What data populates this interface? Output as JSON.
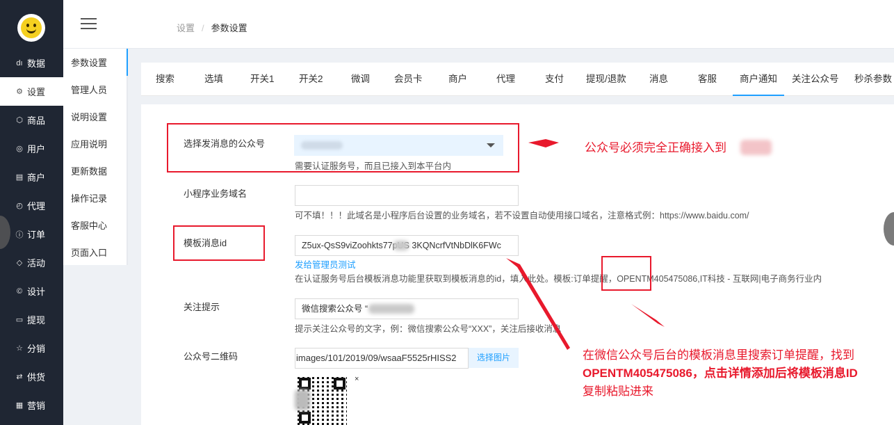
{
  "sidebar": {
    "items": [
      {
        "icon": "bar-chart-icon",
        "glyph": "dı",
        "label": "数据"
      },
      {
        "icon": "gear-icon",
        "glyph": "⚙",
        "label": "设置"
      },
      {
        "icon": "cube-icon",
        "glyph": "⬡",
        "label": "商品"
      },
      {
        "icon": "user-icon",
        "glyph": "◎",
        "label": "用户"
      },
      {
        "icon": "shop-icon",
        "glyph": "▤",
        "label": "商户"
      },
      {
        "icon": "agent-icon",
        "glyph": "◴",
        "label": "代理"
      },
      {
        "icon": "order-icon",
        "glyph": "ⓘ",
        "label": "订单"
      },
      {
        "icon": "tag-icon",
        "glyph": "◇",
        "label": "活动"
      },
      {
        "icon": "design-icon",
        "glyph": "©",
        "label": "设计"
      },
      {
        "icon": "withdraw-icon",
        "glyph": "▭",
        "label": "提现"
      },
      {
        "icon": "star-icon",
        "glyph": "☆",
        "label": "分销"
      },
      {
        "icon": "swap-icon",
        "glyph": "⇄",
        "label": "供货"
      },
      {
        "icon": "grid-icon",
        "glyph": "▦",
        "label": "营销"
      }
    ]
  },
  "submenu": {
    "items": [
      "参数设置",
      "管理人员",
      "说明设置",
      "应用说明",
      "更新数据",
      "操作记录",
      "客服中心",
      "页面入口"
    ]
  },
  "breadcrumb": {
    "parent": "设置",
    "separator": "/",
    "current": "参数设置"
  },
  "tabs": [
    "搜索",
    "选填",
    "开关1",
    "开关2",
    "微调",
    "会员卡",
    "商户",
    "代理",
    "支付",
    "提现/退款",
    "消息",
    "客服",
    "商户通知",
    "关注公众号",
    "秒杀参数"
  ],
  "form": {
    "account": {
      "label": "选择发消息的公众号",
      "hint": "需要认证服务号，而且已接入到本平台内"
    },
    "domain": {
      "label": "小程序业务域名",
      "value": "",
      "hint": "可不填！！！此域名是小程序后台设置的业务域名，若不设置自动使用接口域名，注意格式例：https://www.baidu.com/"
    },
    "template": {
      "label": "模板消息id",
      "value": "Z5ux-QsS9viZoohkts77pUS  3KQNcrfVtNbDlK6FWc",
      "link": "发给管理员测试",
      "hint": "在认证服务号后台模板消息功能里获取到模板消息的id，填入此处。模板:订单提醒，OPENTM405475086,IT科技 - 互联网|电子商务行业内"
    },
    "follow": {
      "label": "关注提示",
      "value": "微信搜索公众号 “",
      "hint": "提示关注公众号的文字，例：微信搜索公众号“XXX”，关注后接收消息"
    },
    "qrcode": {
      "label": "公众号二维码",
      "value": "images/101/2019/09/wsaaF5525rHISS2",
      "button": "选择图片",
      "close": "×"
    }
  },
  "annotations": {
    "note1": "公众号必须完全正确接入到",
    "note2_lines": [
      "在微信公众号后台的模板消息里搜索订单提醒，找到",
      "OPENTM405475086，点击详情添加后将模板消息ID",
      "复制粘贴进来"
    ]
  },
  "colors": {
    "sidebar_bg": "#1f2633",
    "accent": "#1e9fff",
    "annotation_red": "#e8192c"
  }
}
